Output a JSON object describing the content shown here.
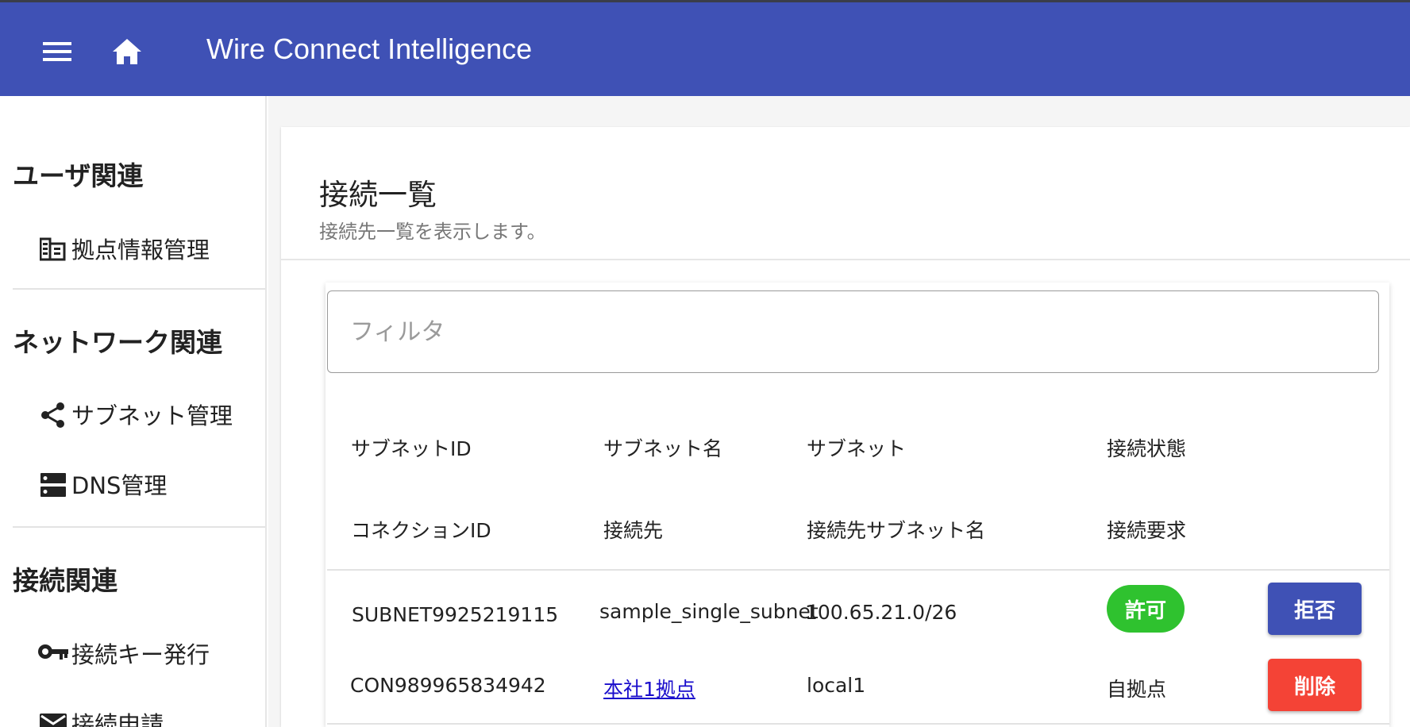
{
  "appbar": {
    "title": "Wire Connect Intelligence",
    "menu_icon": "menu-icon",
    "home_icon": "home-icon",
    "color": "#3f51b5"
  },
  "sidebar": {
    "sections": [
      {
        "heading": "ユーザ関連",
        "items": [
          {
            "label": "拠点情報管理",
            "icon": "building-icon"
          }
        ]
      },
      {
        "heading": "ネットワーク関連",
        "items": [
          {
            "label": "サブネット管理",
            "icon": "share-icon"
          },
          {
            "label": "DNS管理",
            "icon": "dns-icon"
          }
        ]
      },
      {
        "heading": "接続関連",
        "items": [
          {
            "label": "接続キー発行",
            "icon": "key-icon"
          },
          {
            "label": "接続申請",
            "icon": "mail-icon"
          }
        ]
      }
    ]
  },
  "main": {
    "title": "接続一覧",
    "subtitle": "接続先一覧を表示します。",
    "filter_placeholder": "フィルタ",
    "headers_row1": [
      "サブネットID",
      "サブネット名",
      "サブネット",
      "接続状態"
    ],
    "headers_row2": [
      "コネクションID",
      "接続先",
      "接続先サブネット名",
      "接続要求"
    ],
    "rows": [
      {
        "subnet_id": "SUBNET9925219115",
        "subnet_name": "sample_single_subnet",
        "subnet": "100.65.21.0/26",
        "status": "許可",
        "deny_label": "拒否",
        "connection_id": "CON989965834942",
        "destination": "本社1拠点",
        "dest_subnet_name": "local1",
        "request": "自拠点",
        "delete_label": "削除"
      }
    ]
  },
  "colors": {
    "primary": "#3f51b5",
    "success": "#2fc22f",
    "danger": "#f44336",
    "link": "#1a0dcc"
  }
}
